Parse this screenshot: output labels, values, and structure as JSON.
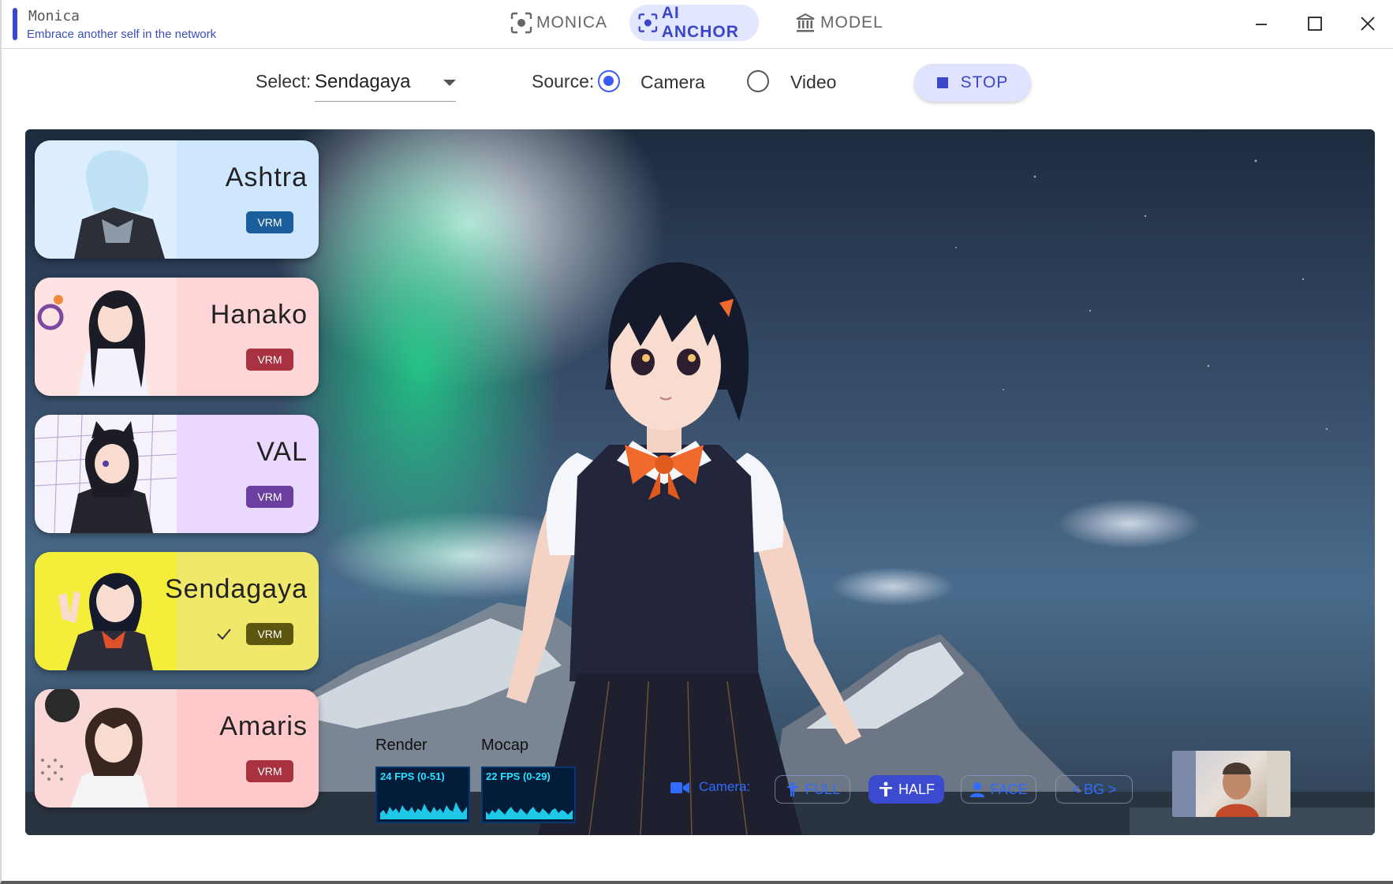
{
  "app": {
    "name": "Monica",
    "tagline": "Embrace another self in the network",
    "accent_color": "#3c46c8"
  },
  "nav": {
    "tabs": [
      {
        "label": "MONICA",
        "icon": "focus-frame-icon",
        "active": false
      },
      {
        "label": "AI ANCHOR",
        "icon": "focus-frame-icon",
        "active": true
      },
      {
        "label": "MODEL",
        "icon": "bank-icon",
        "active": false
      }
    ]
  },
  "window_controls": [
    "minimize-icon",
    "maximize-icon",
    "close-icon"
  ],
  "toolbar": {
    "select_label": "Select:",
    "select_value": "Sendagaya",
    "source_label": "Source:",
    "source_options": [
      {
        "label": "Camera",
        "checked": true
      },
      {
        "label": "Video",
        "checked": false
      }
    ],
    "stop_label": "STOP"
  },
  "models": [
    {
      "name": "Ashtra",
      "badge": "VRM",
      "bg": "#cfe6ff",
      "badge_color": "#1a5f9c",
      "selected": false
    },
    {
      "name": "Hanako",
      "badge": "VRM",
      "bg": "#ffd6d8",
      "badge_color": "#a83240",
      "selected": false
    },
    {
      "name": "VAL",
      "badge": "VRM",
      "bg": "#ead8ff",
      "badge_color": "#6a3fa0",
      "selected": false
    },
    {
      "name": "Sendagaya",
      "badge": "VRM",
      "bg": "#f0e86a",
      "badge_color": "#5c560f",
      "selected": true
    },
    {
      "name": "Amaris",
      "badge": "VRM",
      "bg": "#ffc9cc",
      "badge_color": "#a83240",
      "selected": false
    }
  ],
  "perf": {
    "render_label": "Render",
    "render_value": "24 FPS (0-51)",
    "mocap_label": "Mocap",
    "mocap_value": "22 FPS (0-29)"
  },
  "camera": {
    "label": "Camera:",
    "options": [
      {
        "label": "FULL",
        "icon": "full-body-icon",
        "active": false
      },
      {
        "label": "HALF",
        "icon": "half-body-icon",
        "active": true
      },
      {
        "label": "FACE",
        "icon": "face-icon",
        "active": false
      },
      {
        "label": "< BG >",
        "icon": "",
        "active": false
      }
    ]
  }
}
